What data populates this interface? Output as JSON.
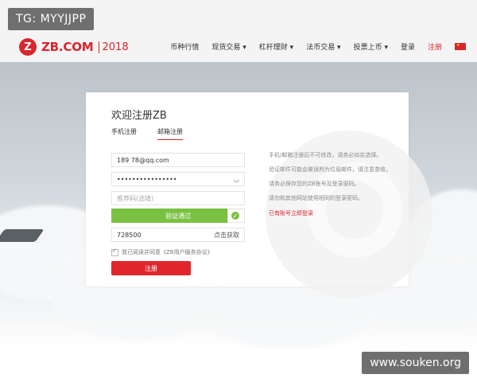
{
  "watermarks": {
    "top": "TG: MYYJJPP",
    "bottom": "www.souken.org"
  },
  "header": {
    "logo_mark": "Z",
    "logo_text": "ZB.COM",
    "logo_year": "2018",
    "nav": [
      "币种行情",
      "现货交易 ▾",
      "杠杆理财 ▾",
      "法币交易 ▾",
      "投票上币 ▾",
      "登录",
      "注册"
    ]
  },
  "form": {
    "title": "欢迎注册ZB",
    "tabs": [
      "手机注册",
      "邮箱注册"
    ],
    "email_value": "189        78@qq.com",
    "password_value": "••••••••••••••••",
    "referral_placeholder": "推荐码(选填)",
    "verify_label": "验证通过",
    "code_value": "728500",
    "get_code_label": "点击获取",
    "agree_text": "我已阅读并同意《ZB用户服务协议》",
    "submit_label": "注册"
  },
  "notes": {
    "line1": "手机/邮箱注册后不可修改，请务必如实选择。",
    "line2": "验证邮件可能会被误判为垃圾邮件，请注意查收。",
    "line3": "请务必保存您的ZB账号及登录密码。",
    "line4": "请勿和其他网站使用相同的登录密码。",
    "login_link": "已有账号立即登录"
  },
  "colors": {
    "brand": "#d9252d",
    "verify": "#7ac143"
  }
}
